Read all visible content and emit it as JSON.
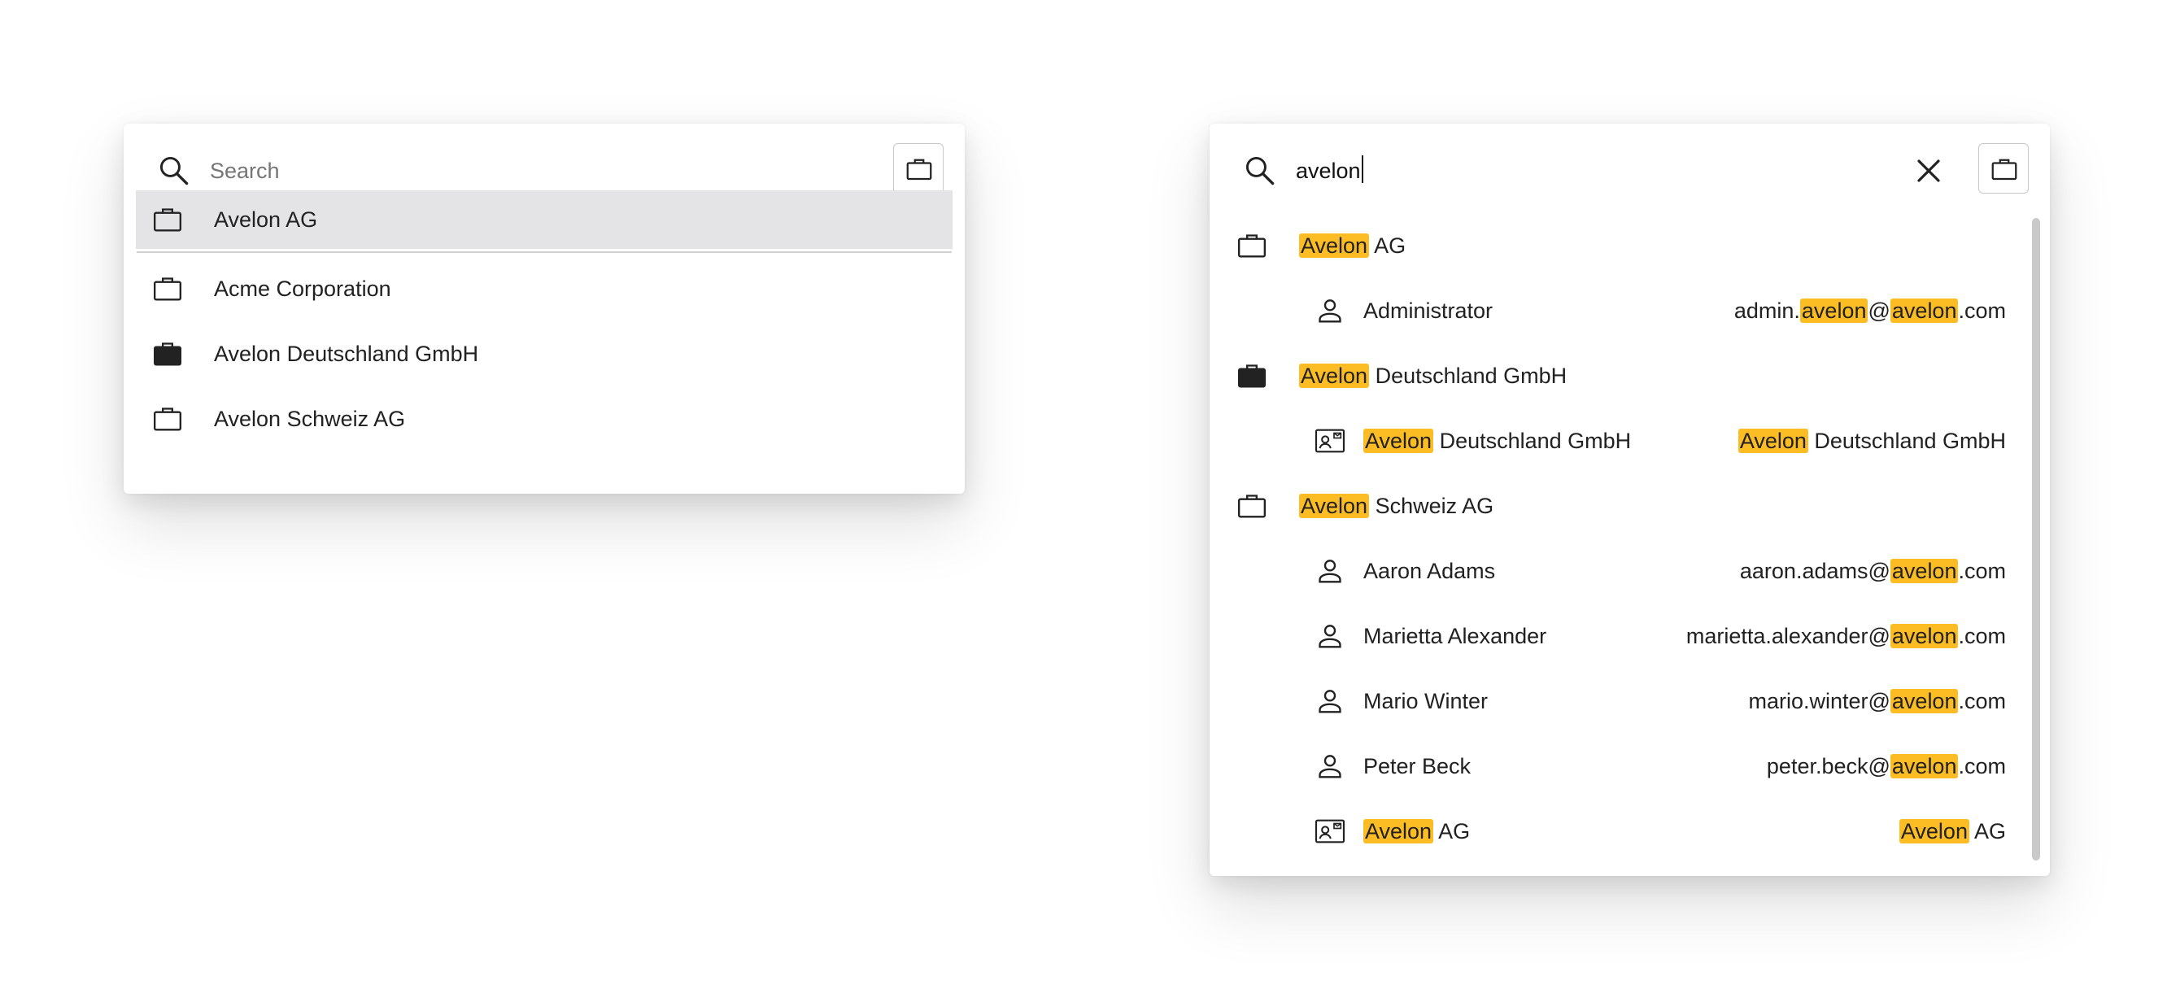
{
  "left": {
    "search": {
      "placeholder": "Search"
    },
    "results": [
      {
        "label": "Avelon AG",
        "icon": "briefcase-outline-icon",
        "selected": true
      },
      {
        "label": "Acme Corporation",
        "icon": "briefcase-outline-icon"
      },
      {
        "label": "Avelon Deutschland GmbH",
        "icon": "briefcase-filled-icon"
      },
      {
        "label": "Avelon Schweiz AG",
        "icon": "briefcase-outline-icon"
      }
    ]
  },
  "right": {
    "search": {
      "query": "avelon"
    },
    "highlight_color": "#fbbd23",
    "results": [
      {
        "type": "company",
        "icon": "briefcase-outline-icon",
        "name": [
          "Avelon",
          " AG"
        ]
      },
      {
        "type": "user",
        "icon": "person-icon",
        "name": [
          "Administrator"
        ],
        "detail": [
          "admin.",
          "avelon",
          "@",
          "avelon",
          ".com"
        ]
      },
      {
        "type": "company",
        "icon": "briefcase-filled-icon",
        "name": [
          "Avelon",
          " Deutschland GmbH"
        ]
      },
      {
        "type": "contact",
        "icon": "contact-card-icon",
        "name": [
          "Avelon",
          " Deutschland GmbH"
        ],
        "detail": [
          "Avelon",
          " Deutschland GmbH"
        ]
      },
      {
        "type": "company",
        "icon": "briefcase-outline-icon",
        "name": [
          "Avelon",
          " Schweiz AG"
        ]
      },
      {
        "type": "user",
        "icon": "person-icon",
        "name": [
          "Aaron Adams"
        ],
        "detail": [
          "aaron.adams@",
          "avelon",
          ".com"
        ]
      },
      {
        "type": "user",
        "icon": "person-icon",
        "name": [
          "Marietta Alexander"
        ],
        "detail": [
          "marietta.alexander@",
          "avelon",
          ".com"
        ]
      },
      {
        "type": "user",
        "icon": "person-icon",
        "name": [
          "Mario Winter"
        ],
        "detail": [
          "mario.winter@",
          "avelon",
          ".com"
        ]
      },
      {
        "type": "user",
        "icon": "person-icon",
        "name": [
          "Peter Beck"
        ],
        "detail": [
          "peter.beck@",
          "avelon",
          ".com"
        ]
      },
      {
        "type": "contact",
        "icon": "contact-card-icon",
        "name": [
          "Avelon",
          " AG"
        ],
        "detail": [
          "Avelon",
          " AG"
        ]
      }
    ]
  }
}
